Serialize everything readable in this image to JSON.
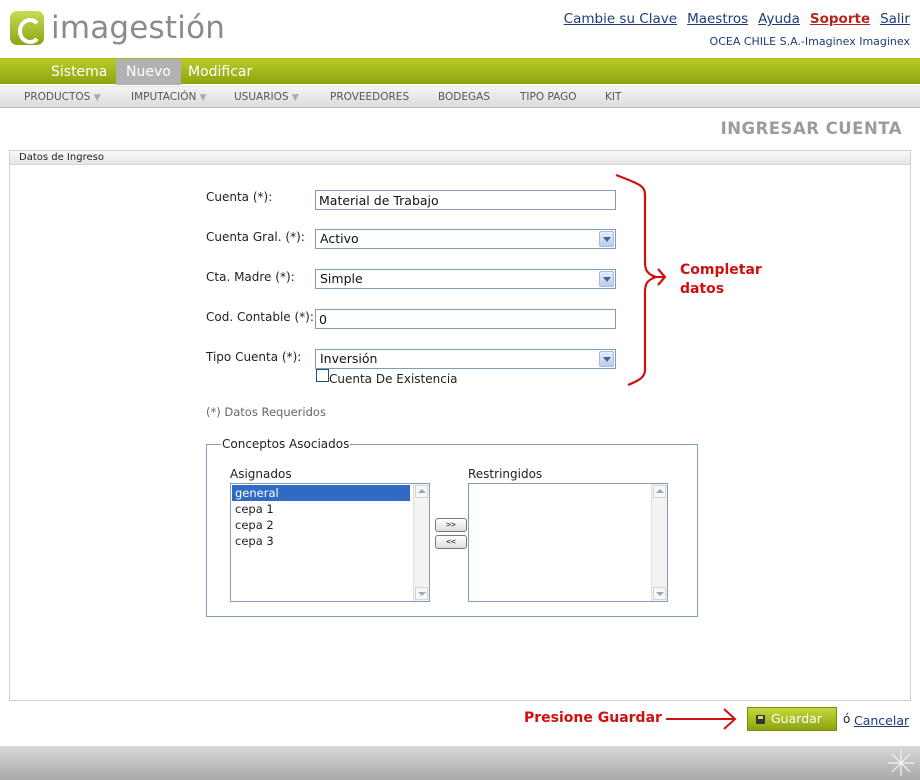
{
  "header": {
    "logo_text": "imagestión",
    "links": [
      "Cambie su Clave",
      "Maestros",
      "Ayuda",
      "Soporte",
      "Salir"
    ],
    "company": "OCEA CHILE S.A.-Imaginex Imaginex"
  },
  "menu": {
    "items": [
      "Sistema",
      "Nuevo",
      "Modificar"
    ],
    "active": "Nuevo"
  },
  "submenu": {
    "items": [
      "PRODUCTOS",
      "IMPUTACIÓN",
      "USUARIOS",
      "PROVEEDORES",
      "BODEGAS",
      "TIPO PAGO",
      "KIT"
    ],
    "arrow": "▼"
  },
  "page_title": "INGRESAR CUENTA",
  "panel_title": "Datos de Ingreso",
  "form": {
    "cuenta_label": "Cuenta (*):",
    "cuenta_value": "Material de Trabajo",
    "cuenta_gral_label": "Cuenta Gral. (*):",
    "cuenta_gral_value": "Activo",
    "cta_madre_label": "Cta. Madre (*):",
    "cta_madre_value": "Simple",
    "cod_contable_label": "Cod. Contable (*):",
    "cod_contable_value": "0",
    "tipo_cuenta_label": "Tipo Cuenta (*):",
    "tipo_cuenta_value": "Inversión",
    "existencia_label": "Cuenta De Existencia",
    "existencia_checked": false,
    "required_note": "(*) Datos Requeridos"
  },
  "concepts": {
    "legend": "Conceptos Asociados",
    "assigned_label": "Asignados",
    "restricted_label": "Restringidos",
    "assigned": [
      "general",
      "cepa 1",
      "cepa 2",
      "cepa 3"
    ],
    "assigned_selected": "general",
    "restricted": [],
    "add_button": ">>",
    "remove_button": "<<"
  },
  "annotations": {
    "completar_line1": "Completar",
    "completar_line2": "datos",
    "presione": "Presione Guardar",
    "color": "#d20f0f"
  },
  "actions": {
    "save": "Guardar",
    "or": "ó",
    "cancel": "Cancelar"
  },
  "colors": {
    "brand_green": "#9db41c",
    "link_blue": "#1d3c77",
    "support_red": "#b8261b"
  }
}
